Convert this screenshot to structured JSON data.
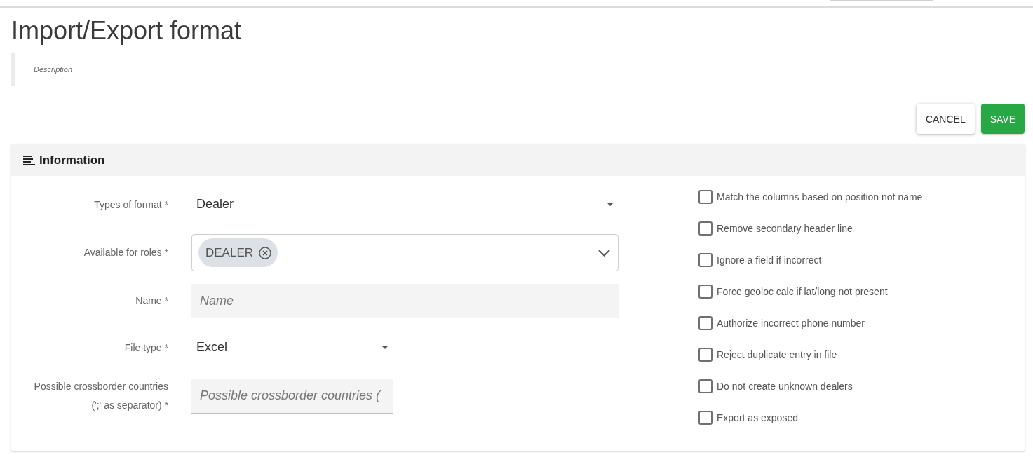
{
  "page": {
    "title": "Import/Export format",
    "description": "Description"
  },
  "actions": [
    {
      "label": "CANCEL",
      "kind": "secondary"
    },
    {
      "label": "SAVE",
      "kind": "primary"
    }
  ],
  "card": {
    "title": "Information",
    "fields": [
      {
        "kind": "select",
        "label": "Types of format *",
        "value": "Dealer"
      },
      {
        "kind": "multiselect",
        "label": "Available for roles *",
        "chips": [
          "DEALER"
        ]
      },
      {
        "kind": "text",
        "label": "Name *",
        "placeholder": "Name"
      },
      {
        "kind": "select",
        "label": "File type *",
        "value": "Excel"
      },
      {
        "kind": "text",
        "label": "Possible crossborder countries (';' as separator) *",
        "placeholder": "Possible crossborder countries ("
      }
    ],
    "options": [
      {
        "label": "Match the columns based on position not name",
        "checked": false
      },
      {
        "label": "Remove secondary header line",
        "checked": false
      },
      {
        "label": "Ignore a field if incorrect",
        "checked": false
      },
      {
        "label": "Force geoloc calc if lat/long not present",
        "checked": false
      },
      {
        "label": "Authorize incorrect phone number",
        "checked": false
      },
      {
        "label": "Reject duplicate entry in file",
        "checked": false
      },
      {
        "label": "Do not create unknown dealers",
        "checked": false
      },
      {
        "label": "Export as exposed",
        "checked": false
      }
    ]
  }
}
